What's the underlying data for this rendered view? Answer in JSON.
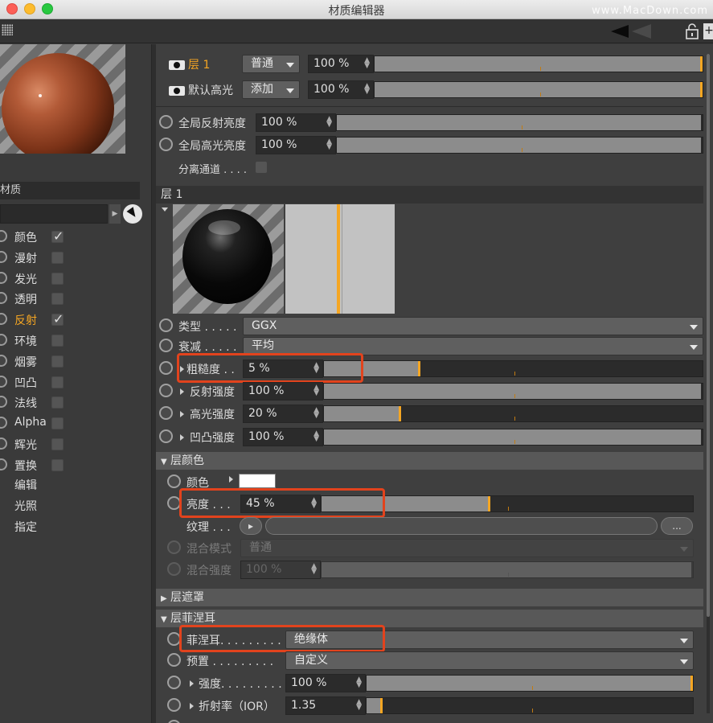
{
  "window": {
    "title": "材质编辑器",
    "watermark": "www.MacDown.com"
  },
  "left": {
    "material_name": "材质",
    "channels": [
      {
        "label": "颜色",
        "checked": true,
        "active": false
      },
      {
        "label": "漫射",
        "checked": false,
        "active": false
      },
      {
        "label": "发光",
        "checked": false,
        "active": false
      },
      {
        "label": "透明",
        "checked": false,
        "active": false
      },
      {
        "label": "反射",
        "checked": true,
        "active": true
      },
      {
        "label": "环境",
        "checked": false,
        "active": false
      },
      {
        "label": "烟雾",
        "checked": false,
        "active": false
      },
      {
        "label": "凹凸",
        "checked": false,
        "active": false
      },
      {
        "label": "法线",
        "checked": false,
        "active": false
      },
      {
        "label": "Alpha",
        "checked": false,
        "active": false
      },
      {
        "label": "辉光",
        "checked": false,
        "active": false
      },
      {
        "label": "置换",
        "checked": false,
        "active": false
      }
    ],
    "extras": [
      "编辑",
      "光照",
      "指定"
    ]
  },
  "layers": [
    {
      "name": "层 1",
      "mode": "普通",
      "value": "100 %",
      "fill_fraction": 1.0
    },
    {
      "name": "默认高光",
      "mode": "添加",
      "value": "100 %",
      "fill_fraction": 1.0
    }
  ],
  "global": {
    "reflection_label": "全局反射亮度",
    "reflection_value": "100 %",
    "specular_label": "全局高光亮度",
    "specular_value": "100 %",
    "separate_label": "分离通道 . . . ."
  },
  "layer1": {
    "header": "层 1",
    "type_label": "类型 . . . . .",
    "type_value": "GGX",
    "falloff_label": "衰减 . . . . .",
    "falloff_value": "平均",
    "roughness_label": "粗糙度 . .",
    "roughness_value": "5 %",
    "roughness_fraction": 0.05,
    "refl_strength_label": "反射强度",
    "refl_strength_value": "100 %",
    "spec_strength_label": "高光强度",
    "spec_strength_value": "20 %",
    "spec_fraction": 0.2,
    "bump_strength_label": "凹凸强度",
    "bump_strength_value": "100 %"
  },
  "layer_color": {
    "header": "层颜色",
    "color_label": "颜色",
    "color_value": "#ffffff",
    "brightness_label": "亮度 . . .",
    "brightness_value": "45 %",
    "brightness_fraction": 0.45,
    "texture_label": "纹理 . . .",
    "texture_button": "...",
    "blend_mode_label": "混合模式",
    "blend_mode_value": "普通",
    "blend_strength_label": "混合强度",
    "blend_strength_value": "100 %"
  },
  "layer_mask": {
    "header": "层遮罩"
  },
  "layer_fresnel": {
    "header": "层菲涅耳",
    "fresnel_label": "菲涅耳. . . . . . . . .",
    "fresnel_value": "绝缘体",
    "preset_label": "预置 . . . . . . . . .",
    "preset_value": "自定义",
    "strength_label": "强度. . . . . . . . .",
    "strength_value": "100 %",
    "ior_label": "折射率（IOR）",
    "ior_value": "1.35",
    "ior_fraction": 0.02
  },
  "colors": {
    "accent": "#f5a623",
    "highlight_box": "#e2431d"
  }
}
